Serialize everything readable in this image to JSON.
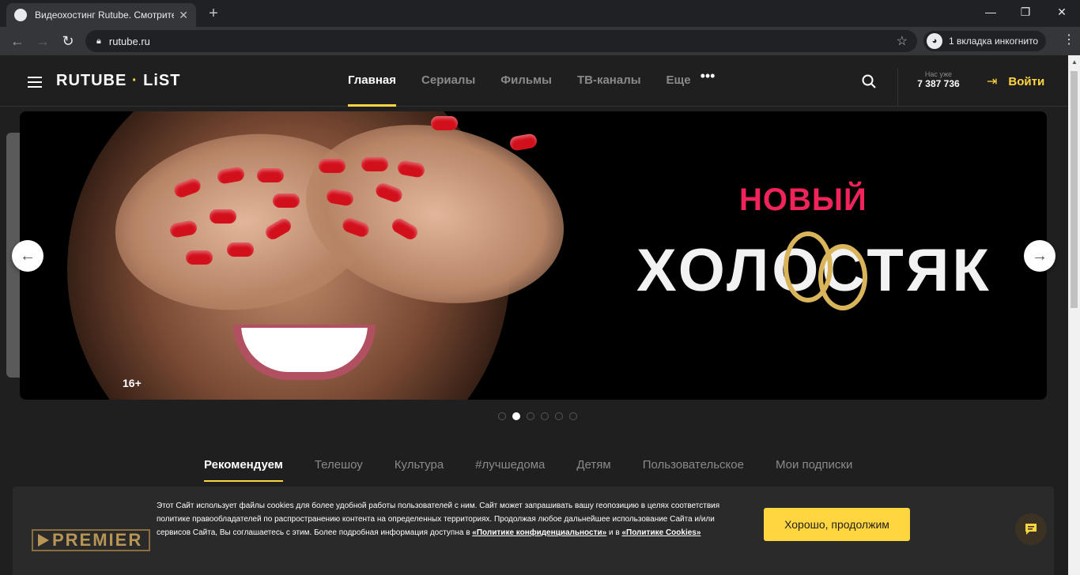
{
  "browser": {
    "tab_title": "Видеохостинг Rutube. Смотрите",
    "tab_close": "✕",
    "new_tab": "+",
    "url": "rutube.ru",
    "incognito_label": "1 вкладка инкогнито",
    "window_minimize": "—",
    "window_restore": "❐",
    "window_close": "✕"
  },
  "header": {
    "logo_left": "RUTUBE",
    "logo_dot": "·",
    "logo_right": "LiST",
    "nav": [
      {
        "label": "Главная"
      },
      {
        "label": "Сериалы"
      },
      {
        "label": "Фильмы"
      },
      {
        "label": "ТВ-каналы"
      },
      {
        "label": "Еще"
      }
    ],
    "more_dots": "•••",
    "counter_label": "Нас уже",
    "counter_value": "7 387 736",
    "login_label": "Войти"
  },
  "banner": {
    "title_top": "НОВЫЙ",
    "title_main": "ХОЛОСТЯК",
    "age_rating": "16+",
    "slides_total": 6,
    "slide_active": 2,
    "accent": "#f0245a"
  },
  "categories": [
    {
      "label": "Рекомендуем"
    },
    {
      "label": "Телешоу"
    },
    {
      "label": "Культура"
    },
    {
      "label": "#лучшедома"
    },
    {
      "label": "Детям"
    },
    {
      "label": "Пользовательское"
    },
    {
      "label": "Мои подписки"
    }
  ],
  "cookie": {
    "logo": "PREMIER",
    "text_1": "Этот Сайт использует файлы cookies для более удобной работы пользователей с ним. Сайт может запрашивать вашу геопозицию в целях соответствия политике правообладателей по распространению контента на определенных территориях. Продолжая любое дальнейшее использование Сайта и/или сервисов Сайта, Вы соглашаетесь с этим. Более подробная информация доступна в ",
    "link_privacy": "«Политике конфиденциальности»",
    "text_and": " и в ",
    "link_cookies": "«Политике Cookies»",
    "button": "Хорошо, продолжим"
  },
  "colors": {
    "accent": "#ffd640",
    "background": "#1f1f1f"
  }
}
